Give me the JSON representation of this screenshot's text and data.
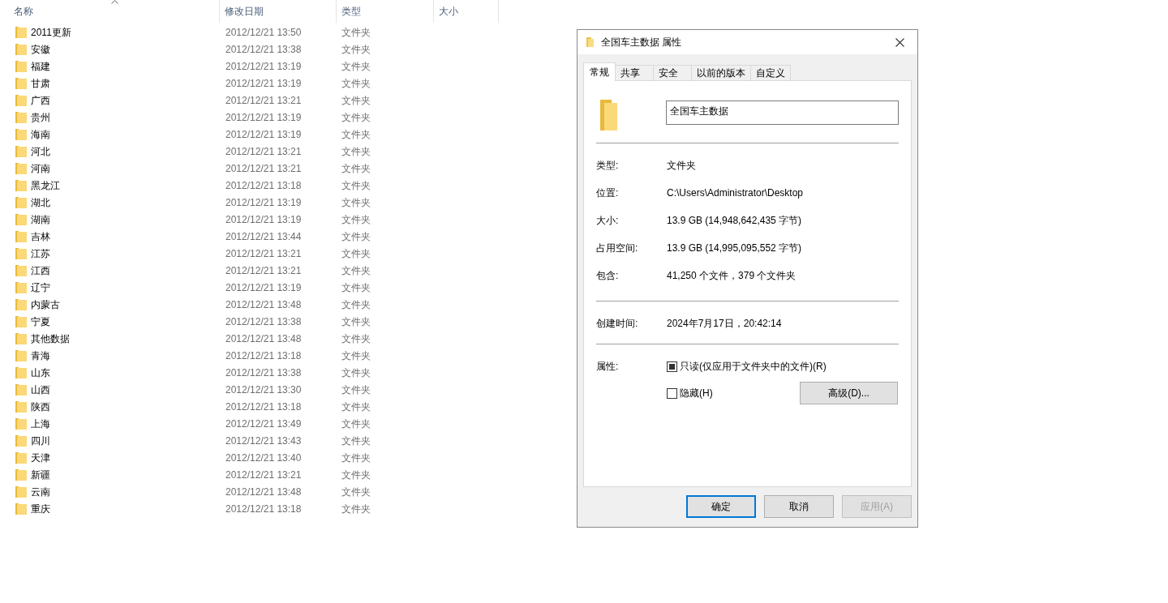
{
  "explorer": {
    "columns": [
      {
        "label": "名称",
        "sorted": true
      },
      {
        "label": "修改日期",
        "sorted": false
      },
      {
        "label": "类型",
        "sorted": false
      },
      {
        "label": "大小",
        "sorted": false
      }
    ],
    "rows": [
      {
        "name": "2011更新",
        "date": "2012/12/21 13:50",
        "type": "文件夹"
      },
      {
        "name": "安徽",
        "date": "2012/12/21 13:38",
        "type": "文件夹"
      },
      {
        "name": "福建",
        "date": "2012/12/21 13:19",
        "type": "文件夹"
      },
      {
        "name": "甘肃",
        "date": "2012/12/21 13:19",
        "type": "文件夹"
      },
      {
        "name": "广西",
        "date": "2012/12/21 13:21",
        "type": "文件夹"
      },
      {
        "name": "贵州",
        "date": "2012/12/21 13:19",
        "type": "文件夹"
      },
      {
        "name": "海南",
        "date": "2012/12/21 13:19",
        "type": "文件夹"
      },
      {
        "name": "河北",
        "date": "2012/12/21 13:21",
        "type": "文件夹"
      },
      {
        "name": "河南",
        "date": "2012/12/21 13:21",
        "type": "文件夹"
      },
      {
        "name": "黑龙江",
        "date": "2012/12/21 13:18",
        "type": "文件夹"
      },
      {
        "name": "湖北",
        "date": "2012/12/21 13:19",
        "type": "文件夹"
      },
      {
        "name": "湖南",
        "date": "2012/12/21 13:19",
        "type": "文件夹"
      },
      {
        "name": "吉林",
        "date": "2012/12/21 13:44",
        "type": "文件夹"
      },
      {
        "name": "江苏",
        "date": "2012/12/21 13:21",
        "type": "文件夹"
      },
      {
        "name": "江西",
        "date": "2012/12/21 13:21",
        "type": "文件夹"
      },
      {
        "name": "辽宁",
        "date": "2012/12/21 13:19",
        "type": "文件夹"
      },
      {
        "name": "内蒙古",
        "date": "2012/12/21 13:48",
        "type": "文件夹"
      },
      {
        "name": "宁夏",
        "date": "2012/12/21 13:38",
        "type": "文件夹"
      },
      {
        "name": "其他数据",
        "date": "2012/12/21 13:48",
        "type": "文件夹"
      },
      {
        "name": "青海",
        "date": "2012/12/21 13:18",
        "type": "文件夹"
      },
      {
        "name": "山东",
        "date": "2012/12/21 13:38",
        "type": "文件夹"
      },
      {
        "name": "山西",
        "date": "2012/12/21 13:30",
        "type": "文件夹"
      },
      {
        "name": "陕西",
        "date": "2012/12/21 13:18",
        "type": "文件夹"
      },
      {
        "name": "上海",
        "date": "2012/12/21 13:49",
        "type": "文件夹"
      },
      {
        "name": "四川",
        "date": "2012/12/21 13:43",
        "type": "文件夹"
      },
      {
        "name": "天津",
        "date": "2012/12/21 13:40",
        "type": "文件夹"
      },
      {
        "name": "新疆",
        "date": "2012/12/21 13:21",
        "type": "文件夹"
      },
      {
        "name": "云南",
        "date": "2012/12/21 13:48",
        "type": "文件夹"
      },
      {
        "name": "重庆",
        "date": "2012/12/21 13:18",
        "type": "文件夹"
      }
    ]
  },
  "dialog": {
    "title": "全国车主数据 属性",
    "tabs": [
      {
        "label": "常规",
        "selected": true
      },
      {
        "label": "共享",
        "selected": false
      },
      {
        "label": "安全",
        "selected": false
      },
      {
        "label": "以前的版本",
        "selected": false
      },
      {
        "label": "自定义",
        "selected": false
      }
    ],
    "name_field": {
      "value": "全国车主数据"
    },
    "groups": [
      [
        {
          "label": "类型:",
          "value": "文件夹"
        },
        {
          "label": "位置:",
          "value": "C:\\Users\\Administrator\\Desktop"
        },
        {
          "label": "大小:",
          "value": "13.9 GB (14,948,642,435 字节)"
        },
        {
          "label": "占用空间:",
          "value": "13.9 GB (14,995,095,552 字节)"
        },
        {
          "label": "包含:",
          "value": "41,250 个文件，379 个文件夹"
        }
      ],
      [
        {
          "label": "创建时间:",
          "value": "2024年7月17日，20:42:14"
        }
      ]
    ],
    "attributes_label": "属性:",
    "checkboxes": [
      {
        "label": "只读(仅应用于文件夹中的文件)(R)",
        "checked": true,
        "indeterminate": true
      },
      {
        "label": "隐藏(H)",
        "checked": false,
        "indeterminate": false
      }
    ],
    "advanced_button": "高级(D)...",
    "buttons": [
      {
        "label": "确定",
        "focused": true,
        "disabled": false
      },
      {
        "label": "取消",
        "focused": false,
        "disabled": false
      },
      {
        "label": "应用(A)",
        "focused": false,
        "disabled": true
      }
    ]
  }
}
